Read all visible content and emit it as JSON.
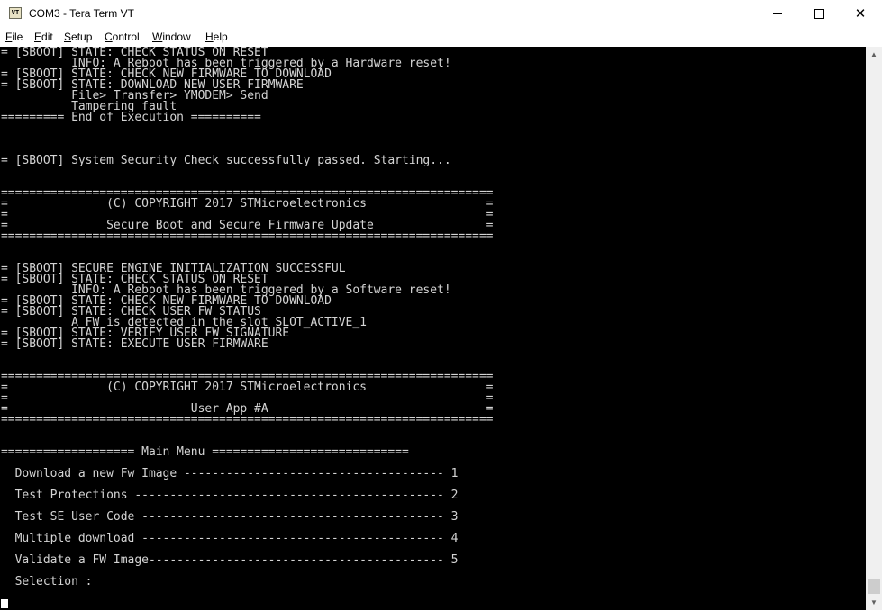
{
  "window": {
    "title": "COM3 - Tera Term VT",
    "icon_label": "VT",
    "close_glyph": "✕"
  },
  "menu": {
    "items": [
      {
        "first": "F",
        "rest": "ile"
      },
      {
        "first": "E",
        "rest": "dit"
      },
      {
        "first": "S",
        "rest": "etup"
      },
      {
        "first": "C",
        "rest": "ontrol"
      },
      {
        "first": "W",
        "rest": "indow"
      },
      {
        "first": "H",
        "rest": "elp"
      }
    ]
  },
  "scrollbar": {
    "up_glyph": "▲",
    "down_glyph": "▼"
  },
  "terminal": {
    "lines": [
      "= [SBOOT] STATE: CHECK STATUS ON RESET",
      "          INFO: A Reboot has been triggered by a Hardware reset!",
      "= [SBOOT] STATE: CHECK NEW FIRMWARE TO DOWNLOAD",
      "= [SBOOT] STATE: DOWNLOAD NEW USER FIRMWARE",
      "          File> Transfer> YMODEM> Send",
      "          Tampering fault",
      "========= End of Execution ==========",
      "",
      "",
      "",
      "= [SBOOT] System Security Check successfully passed. Starting...",
      "",
      "",
      "======================================================================",
      "=              (C) COPYRIGHT 2017 STMicroelectronics                 =",
      "=                                                                    =",
      "=              Secure Boot and Secure Firmware Update                =",
      "======================================================================",
      "",
      "",
      "= [SBOOT] SECURE ENGINE INITIALIZATION SUCCESSFUL",
      "= [SBOOT] STATE: CHECK STATUS ON RESET",
      "          INFO: A Reboot has been triggered by a Software reset!",
      "= [SBOOT] STATE: CHECK NEW FIRMWARE TO DOWNLOAD",
      "= [SBOOT] STATE: CHECK USER FW STATUS",
      "          A FW is detected in the slot SLOT_ACTIVE_1",
      "= [SBOOT] STATE: VERIFY USER FW SIGNATURE",
      "= [SBOOT] STATE: EXECUTE USER FIRMWARE",
      "",
      "",
      "======================================================================",
      "=              (C) COPYRIGHT 2017 STMicroelectronics                 =",
      "=                                                                    =",
      "=                          User App #A                               =",
      "======================================================================",
      "",
      "",
      "=================== Main Menu ============================",
      "",
      "  Download a new Fw Image ------------------------------------- 1",
      "",
      "  Test Protections -------------------------------------------- 2",
      "",
      "  Test SE User Code ------------------------------------------- 3",
      "",
      "  Multiple download ------------------------------------------- 4",
      "",
      "  Validate a FW Image------------------------------------------ 5",
      "",
      "  Selection :"
    ]
  }
}
